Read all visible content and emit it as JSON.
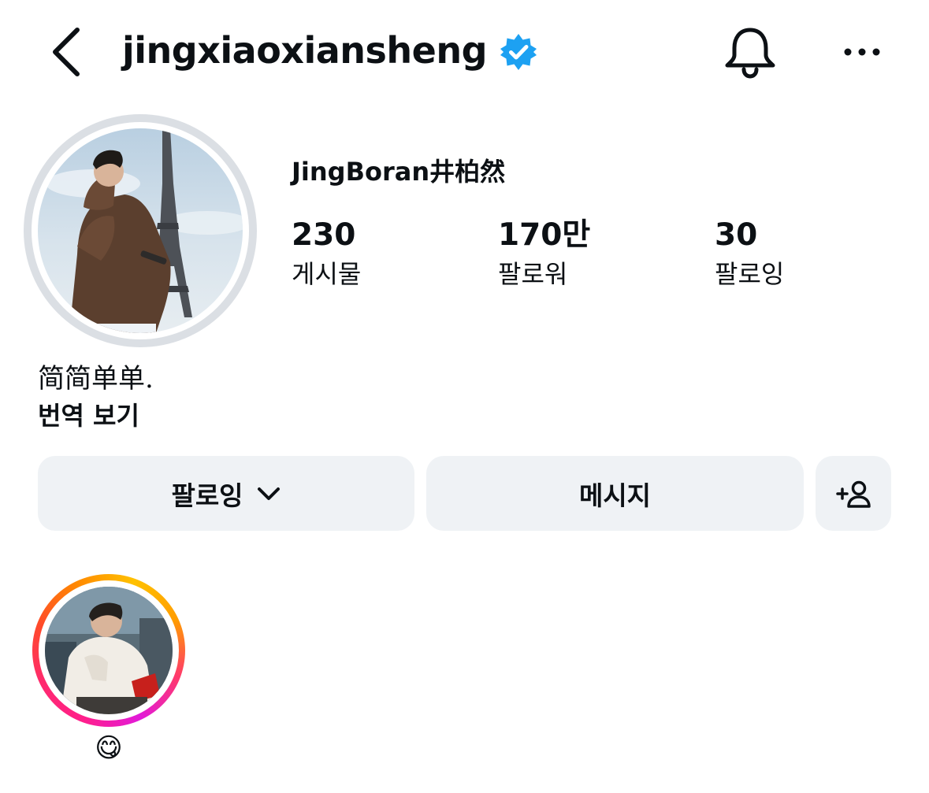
{
  "header": {
    "username": "jingxiaoxiansheng",
    "verified": true,
    "icons": {
      "back": "chevron-left-icon",
      "verified": "verified-badge-icon",
      "notifications": "bell-icon",
      "more": "more-horizontal-icon"
    }
  },
  "profile": {
    "full_name": "JingBoran井柏然",
    "stats": {
      "posts": {
        "value": "230",
        "label": "게시물"
      },
      "followers": {
        "value": "170만",
        "label": "팔로워"
      },
      "following": {
        "value": "30",
        "label": "팔로잉"
      }
    },
    "bio": "简简单单.",
    "translate_label": "번역 보기"
  },
  "actions": {
    "follow_label": "팔로잉",
    "message_label": "메시지",
    "icons": {
      "follow_dropdown": "chevron-down-icon",
      "add_person": "add-person-icon"
    }
  },
  "highlights": [
    {
      "label": "😋"
    }
  ],
  "colors": {
    "text": "#0c1014",
    "button_bg": "#eff2f5",
    "verified_blue": "#1da1f2",
    "avatar_ring": "#dbdfe4",
    "story_gradient_pink": "#ff1f8b",
    "story_gradient_orange": "#ff8a00",
    "story_gradient_yellow": "#ffc100"
  }
}
